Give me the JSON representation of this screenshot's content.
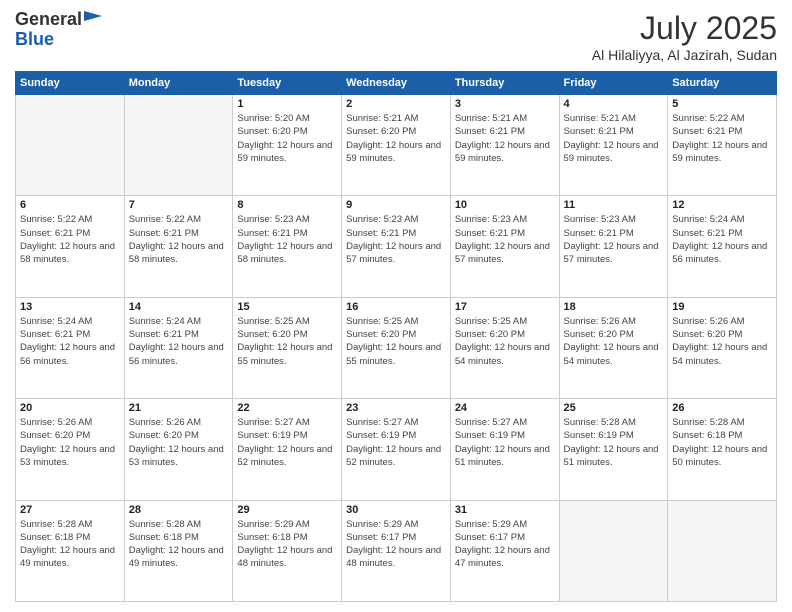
{
  "header": {
    "logo_line1": "General",
    "logo_line2": "Blue",
    "month": "July 2025",
    "location": "Al Hilaliyya, Al Jazirah, Sudan"
  },
  "days_of_week": [
    "Sunday",
    "Monday",
    "Tuesday",
    "Wednesday",
    "Thursday",
    "Friday",
    "Saturday"
  ],
  "weeks": [
    [
      {
        "day": "",
        "empty": true
      },
      {
        "day": "",
        "empty": true
      },
      {
        "day": "1",
        "sunrise": "5:20 AM",
        "sunset": "6:20 PM",
        "daylight": "12 hours and 59 minutes."
      },
      {
        "day": "2",
        "sunrise": "5:21 AM",
        "sunset": "6:20 PM",
        "daylight": "12 hours and 59 minutes."
      },
      {
        "day": "3",
        "sunrise": "5:21 AM",
        "sunset": "6:21 PM",
        "daylight": "12 hours and 59 minutes."
      },
      {
        "day": "4",
        "sunrise": "5:21 AM",
        "sunset": "6:21 PM",
        "daylight": "12 hours and 59 minutes."
      },
      {
        "day": "5",
        "sunrise": "5:22 AM",
        "sunset": "6:21 PM",
        "daylight": "12 hours and 59 minutes."
      }
    ],
    [
      {
        "day": "6",
        "sunrise": "5:22 AM",
        "sunset": "6:21 PM",
        "daylight": "12 hours and 58 minutes."
      },
      {
        "day": "7",
        "sunrise": "5:22 AM",
        "sunset": "6:21 PM",
        "daylight": "12 hours and 58 minutes."
      },
      {
        "day": "8",
        "sunrise": "5:23 AM",
        "sunset": "6:21 PM",
        "daylight": "12 hours and 58 minutes."
      },
      {
        "day": "9",
        "sunrise": "5:23 AM",
        "sunset": "6:21 PM",
        "daylight": "12 hours and 57 minutes."
      },
      {
        "day": "10",
        "sunrise": "5:23 AM",
        "sunset": "6:21 PM",
        "daylight": "12 hours and 57 minutes."
      },
      {
        "day": "11",
        "sunrise": "5:23 AM",
        "sunset": "6:21 PM",
        "daylight": "12 hours and 57 minutes."
      },
      {
        "day": "12",
        "sunrise": "5:24 AM",
        "sunset": "6:21 PM",
        "daylight": "12 hours and 56 minutes."
      }
    ],
    [
      {
        "day": "13",
        "sunrise": "5:24 AM",
        "sunset": "6:21 PM",
        "daylight": "12 hours and 56 minutes."
      },
      {
        "day": "14",
        "sunrise": "5:24 AM",
        "sunset": "6:21 PM",
        "daylight": "12 hours and 56 minutes."
      },
      {
        "day": "15",
        "sunrise": "5:25 AM",
        "sunset": "6:20 PM",
        "daylight": "12 hours and 55 minutes."
      },
      {
        "day": "16",
        "sunrise": "5:25 AM",
        "sunset": "6:20 PM",
        "daylight": "12 hours and 55 minutes."
      },
      {
        "day": "17",
        "sunrise": "5:25 AM",
        "sunset": "6:20 PM",
        "daylight": "12 hours and 54 minutes."
      },
      {
        "day": "18",
        "sunrise": "5:26 AM",
        "sunset": "6:20 PM",
        "daylight": "12 hours and 54 minutes."
      },
      {
        "day": "19",
        "sunrise": "5:26 AM",
        "sunset": "6:20 PM",
        "daylight": "12 hours and 54 minutes."
      }
    ],
    [
      {
        "day": "20",
        "sunrise": "5:26 AM",
        "sunset": "6:20 PM",
        "daylight": "12 hours and 53 minutes."
      },
      {
        "day": "21",
        "sunrise": "5:26 AM",
        "sunset": "6:20 PM",
        "daylight": "12 hours and 53 minutes."
      },
      {
        "day": "22",
        "sunrise": "5:27 AM",
        "sunset": "6:19 PM",
        "daylight": "12 hours and 52 minutes."
      },
      {
        "day": "23",
        "sunrise": "5:27 AM",
        "sunset": "6:19 PM",
        "daylight": "12 hours and 52 minutes."
      },
      {
        "day": "24",
        "sunrise": "5:27 AM",
        "sunset": "6:19 PM",
        "daylight": "12 hours and 51 minutes."
      },
      {
        "day": "25",
        "sunrise": "5:28 AM",
        "sunset": "6:19 PM",
        "daylight": "12 hours and 51 minutes."
      },
      {
        "day": "26",
        "sunrise": "5:28 AM",
        "sunset": "6:18 PM",
        "daylight": "12 hours and 50 minutes."
      }
    ],
    [
      {
        "day": "27",
        "sunrise": "5:28 AM",
        "sunset": "6:18 PM",
        "daylight": "12 hours and 49 minutes."
      },
      {
        "day": "28",
        "sunrise": "5:28 AM",
        "sunset": "6:18 PM",
        "daylight": "12 hours and 49 minutes."
      },
      {
        "day": "29",
        "sunrise": "5:29 AM",
        "sunset": "6:18 PM",
        "daylight": "12 hours and 48 minutes."
      },
      {
        "day": "30",
        "sunrise": "5:29 AM",
        "sunset": "6:17 PM",
        "daylight": "12 hours and 48 minutes."
      },
      {
        "day": "31",
        "sunrise": "5:29 AM",
        "sunset": "6:17 PM",
        "daylight": "12 hours and 47 minutes."
      },
      {
        "day": "",
        "empty": true
      },
      {
        "day": "",
        "empty": true
      }
    ]
  ]
}
